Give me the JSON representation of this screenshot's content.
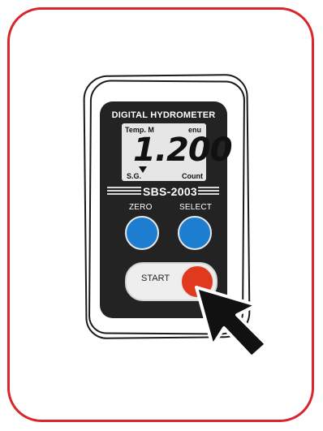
{
  "device": {
    "title": "DIGITAL HYDROMETER",
    "lcd": {
      "top_left": "Temp. M",
      "top_right": "enu",
      "reading": "1.200",
      "bottom_left": "S.G.",
      "bottom_right": "Count"
    },
    "model": "SBS-2003",
    "buttons": {
      "zero": "ZERO",
      "select": "SELECT",
      "start": "START"
    }
  },
  "colors": {
    "frame_border": "#d8262c",
    "body": "#232323",
    "blue_button": "#1d7dd0",
    "red_button": "#e03a1e"
  },
  "icons": [
    "pointer-cursor-icon",
    "lcd-indicator-triangle-icon"
  ]
}
